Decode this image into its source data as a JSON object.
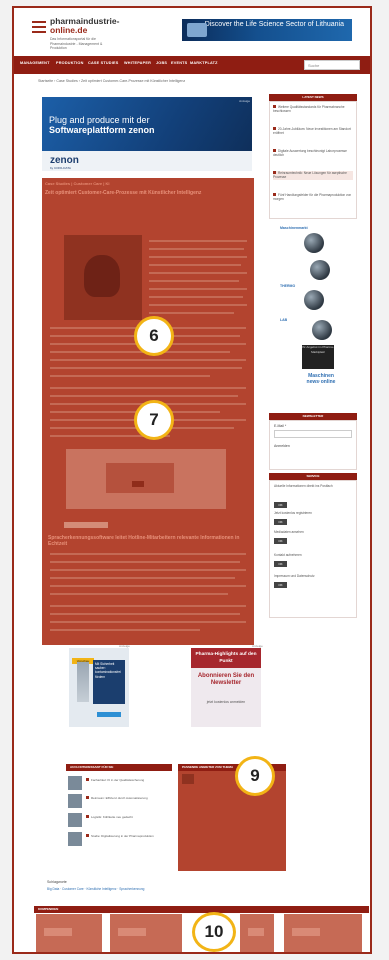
{
  "header": {
    "logo_line1": "pharmaindustrie-",
    "logo_line2": "online.de",
    "logo_tagline": "Das Informationsportal für die Pharmaindustrie - Management & Produktion",
    "banner_text": "Discover the Life Science Sector of Lithuania"
  },
  "nav": {
    "items": [
      "MANAGEMENT",
      "PRODUKTION",
      "CASE STUDIES",
      "WHITEPAPER",
      "JOBS",
      "EVENTS",
      "MARKTPLATZ"
    ],
    "search_placeholder": "Suche"
  },
  "breadcrumb": "Startseite › Case Studies › Zeit optimiert Customer-Care-Prozesse mit Künstlicher Intelligenz",
  "ad_zenon": {
    "line1": "Plug and produce mit der",
    "line2": "Softwareplattform zenon",
    "logo": "zenon",
    "logo_sub": "by COPA-DATA",
    "ad_label": "Anzeige"
  },
  "article": {
    "kicker": "Case Studies | Customer Care | KI",
    "title": "Zeit optimiert Customer-Care-Prozesse mit Künstlicher Intelligenz",
    "subheading": "Spracherkennungssoftware leitet Hotline-Mitarbeitern relevante Informationen in Echtzeit"
  },
  "badges": {
    "b6": "6",
    "b7": "7",
    "b9": "9",
    "b10": "10"
  },
  "sidebar": {
    "latest_head": "LATEST NEWS",
    "news": [
      "Weitere Qualitätsstandards für Pharmabranche beschlossen",
      "20-Jahre-Jubiläum: Neue Investitionen am Standort eröffnet",
      "Digitale Auswertung beschleunigt Laborprozesse deutlich",
      "Reinraumtechnik: Neue Lösungen für aseptische Prozesse",
      "Fünf Handlungsfelder für die Pharmaproduktion von morgen"
    ],
    "machines_tag": "Maschinenmarkt",
    "tag_bio": "THERMO",
    "tag_lab": "LAB",
    "dark_ad": "Ihr Angebot im Pharma-Marktplatz",
    "mach_small_1": "Maschinen",
    "mach_small_2": "news·online",
    "newsletter_head": "NEWSLETTER",
    "email_label": "E-Mail *",
    "anmelden": "Anmelden",
    "service_head": "SERVICE",
    "service_lines": [
      "Aktuelle Informationen direkt ins Postfach",
      "Jetzt kostenlos registrieren",
      "Mediadaten ansehen",
      "Kontakt aufnehmen",
      "Impressum und Datenschutz"
    ],
    "btn_label": "OK"
  },
  "ads_row": {
    "clip_header": "Vorschau",
    "clip_panel": "Mit Sicherheit sauber: kontaminationsfrei fördern",
    "pharma_bar": "Pharma-Highlights auf den Punkt",
    "pharma_text": "Abonnieren Sie den Newsletter",
    "pharma_sub": "jetzt kostenlos anmelden",
    "ad_label": "Anzeige"
  },
  "also": {
    "head": "AUCH INTERESSANT FÜR SIE",
    "items": [
      "Fachartikel: KI in der Qualitätssicherung",
      "Reinraum: Effizienz durch Automatisierung",
      "Logistik: Kühlkette neu gedacht",
      "Studie: Digitalisierung in der Pharmaproduktion"
    ],
    "right_head": "PASSENDE ANBIETER ZUM THEMA"
  },
  "schlagworte": {
    "label": "Schlagworte",
    "links": "Big Data · Customer Care · Künstliche Intelligenz · Spracherkennung"
  },
  "kompendium_head": "KOMPENDIEN"
}
